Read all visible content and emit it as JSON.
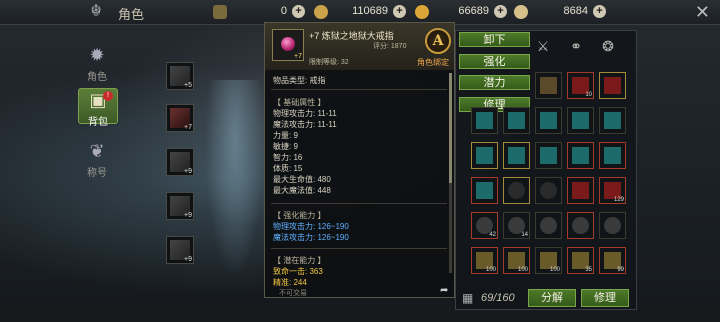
{
  "header": {
    "title": "角色",
    "currencies": [
      {
        "name": "scroll",
        "value": "0",
        "color": "#7a6a3c"
      },
      {
        "name": "coin-ring",
        "value": "110689",
        "color": "#c9a24a"
      },
      {
        "name": "gold-coin",
        "value": "66689",
        "color": "#d9a637"
      },
      {
        "name": "gem",
        "value": "8684",
        "color": "#d8c08a"
      }
    ]
  },
  "nav": [
    {
      "label": "角色",
      "icon": "gear-emblem-icon",
      "active": false
    },
    {
      "label": "背包",
      "icon": "backpack-icon",
      "active": true,
      "badge": "!"
    },
    {
      "label": "称号",
      "icon": "wing-badge-icon",
      "active": false
    }
  ],
  "equipment_left": [
    "+5",
    "+7",
    "+9",
    "+9",
    "+9"
  ],
  "tooltip": {
    "item_name": "+7 炼狱之地狱大戒指",
    "score_label": "评分: 1870",
    "req_label": "限制等级: 32",
    "grade": "A",
    "bind": "角色绑定",
    "type_line": "物品类型:  戒指",
    "icon_level": "+7",
    "base_header": "【 基础属性 】",
    "base_stats": [
      "物理攻击力: 11-11",
      "魔法攻击力: 11-11",
      "力量: 9",
      "敏捷: 9",
      "智力: 16",
      "体质: 15",
      "最大生命值:     480",
      "最大魔法值:     448"
    ],
    "enh_header": "【 强化能力 】",
    "enh_stats": [
      "物理攻击力: 126~190",
      "魔法攻击力: 126~190"
    ],
    "pot_header": "【 潜在能力 】",
    "pot_stats": [
      "致命一击: 363",
      "精准: 244"
    ],
    "footer": "不可交易"
  },
  "actions": [
    "卸下",
    "强化",
    "潜力",
    "修理"
  ],
  "inventory": {
    "capacity": "69/160",
    "btn_decompose": "分解",
    "btn_repair": "修理",
    "counts": [
      "",
      "",
      "",
      "",
      "10",
      "",
      "",
      "",
      "",
      "",
      "",
      "",
      "",
      "",
      "",
      "",
      "",
      "",
      "129",
      "",
      "42",
      "14",
      "",
      "",
      "",
      "100",
      "100",
      "100",
      "35",
      "99"
    ]
  }
}
